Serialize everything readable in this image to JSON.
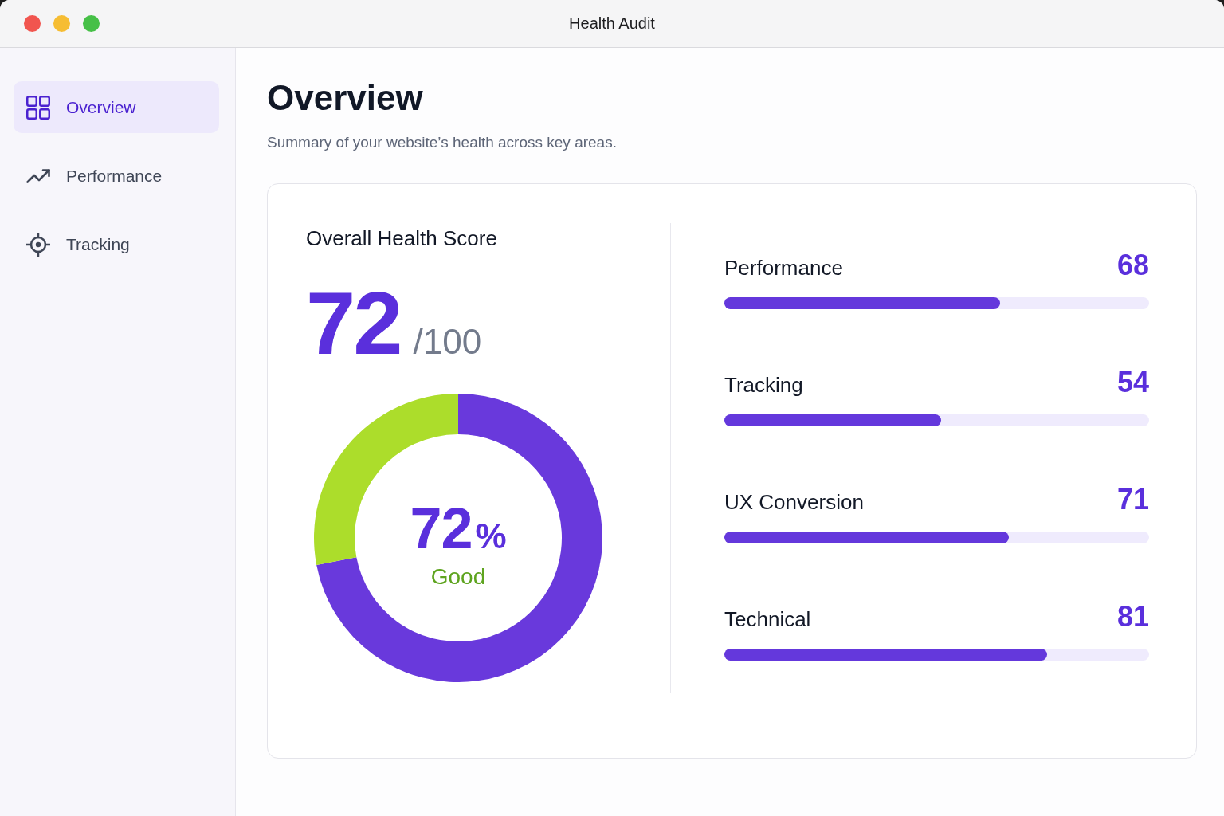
{
  "window": {
    "title": "Health Audit"
  },
  "sidebar": {
    "items": [
      {
        "label": "Overview",
        "selected": true
      },
      {
        "label": "Performance",
        "selected": false
      },
      {
        "label": "Tracking",
        "selected": false
      }
    ]
  },
  "header": {
    "title": "Overview",
    "subtitle": "Summary of your website’s health across key areas."
  },
  "score": {
    "title": "Overall Health Score",
    "value": "72",
    "max": "/100",
    "chart_data": {
      "type": "donut",
      "values": [
        72,
        28
      ],
      "colors": [
        "#6939dc",
        "#acdd2b"
      ]
    },
    "center_value": "72",
    "center_unit": "%",
    "rating": "Good"
  },
  "metrics": [
    {
      "label": "Performance",
      "value": "68",
      "level": 0.65
    },
    {
      "label": "Tracking",
      "value": "54",
      "level": 0.51
    },
    {
      "label": "UX Conversion",
      "value": "71",
      "level": 0.67
    },
    {
      "label": "Technical",
      "value": "81",
      "level": 0.76
    }
  ]
}
